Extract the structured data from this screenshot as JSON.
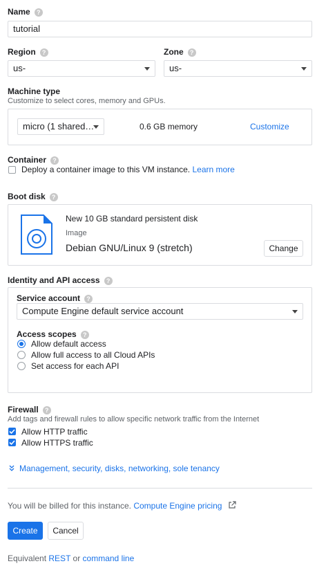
{
  "name": {
    "label": "Name",
    "value": "tutorial"
  },
  "region": {
    "label": "Region",
    "value": "us-"
  },
  "zone": {
    "label": "Zone",
    "value": "us-"
  },
  "machine": {
    "label": "Machine type",
    "subtitle": "Customize to select cores, memory and GPUs.",
    "selected": "micro (1 shared…",
    "memory": "0.6 GB memory",
    "customize": "Customize"
  },
  "container": {
    "label": "Container",
    "checkbox_text": "Deploy a container image to this VM instance.",
    "learn_more": "Learn more"
  },
  "boot_disk": {
    "label": "Boot disk",
    "title": "New 10 GB standard persistent disk",
    "image_label": "Image",
    "image_value": "Debian GNU/Linux 9 (stretch)",
    "change": "Change"
  },
  "identity": {
    "label": "Identity and API access",
    "service_account_label": "Service account",
    "service_account_value": "Compute Engine default service account",
    "scopes_label": "Access scopes",
    "scopes": [
      {
        "label": "Allow default access",
        "selected": true
      },
      {
        "label": "Allow full access to all Cloud APIs",
        "selected": false
      },
      {
        "label": "Set access for each API",
        "selected": false
      }
    ]
  },
  "firewall": {
    "label": "Firewall",
    "subtitle": "Add tags and firewall rules to allow specific network traffic from the Internet",
    "options": [
      {
        "label": "Allow HTTP traffic",
        "checked": true
      },
      {
        "label": "Allow HTTPS traffic",
        "checked": true
      }
    ]
  },
  "more_link": "Management, security, disks, networking, sole tenancy",
  "billing": {
    "text": "You will be billed for this instance.",
    "link": "Compute Engine pricing"
  },
  "actions": {
    "create": "Create",
    "cancel": "Cancel"
  },
  "equivalent": {
    "prefix": "Equivalent",
    "rest": "REST",
    "or": "or",
    "command_line": "command line"
  },
  "colors": {
    "accent": "#1a73e8",
    "border": "#dadce0",
    "text": "#202124",
    "muted": "#5f6368"
  }
}
